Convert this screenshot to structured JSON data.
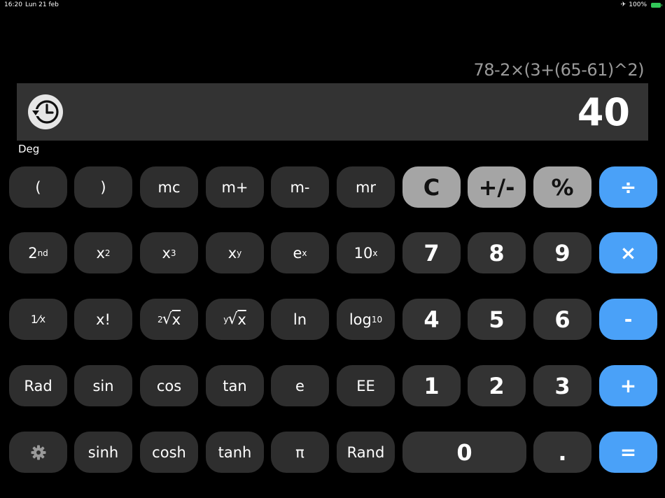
{
  "status": {
    "time": "16:20",
    "date": "Lun 21 feb",
    "battery": "100%"
  },
  "display": {
    "expression": "78-2×(3+(65-61)^2)",
    "result": "40",
    "angle_mode": "Deg"
  },
  "keys": {
    "paren_open": "(",
    "paren_close": ")",
    "mc": "mc",
    "m_plus": "m+",
    "m_minus": "m-",
    "mr": "mr",
    "clear": "C",
    "sign": "+/-",
    "percent": "%",
    "divide": "÷",
    "second_base": "2",
    "second_sup": "nd",
    "x_base": "x",
    "sq_sup": "2",
    "cube_sup": "3",
    "pow_sup": "y",
    "e_base": "e",
    "ex_sup": "x",
    "ten_base": "10",
    "tenx_sup": "x",
    "seven": "7",
    "eight": "8",
    "nine": "9",
    "multiply": "×",
    "reciprocal_num": "1",
    "reciprocal_den": "x",
    "factorial": "x!",
    "sqrt_index": "2",
    "sqrt_sign": "√",
    "sqrt_x": "x",
    "yroot_index": "y",
    "yroot_sign": "√",
    "yroot_x": "x",
    "ln": "ln",
    "log_base": "log",
    "log_sub": "10",
    "four": "4",
    "five": "5",
    "six": "6",
    "minus": "-",
    "rad": "Rad",
    "sin": "sin",
    "cos": "cos",
    "tan": "tan",
    "e": "e",
    "ee": "EE",
    "one": "1",
    "two": "2",
    "three": "3",
    "plus": "+",
    "sinh": "sinh",
    "cosh": "cosh",
    "tanh": "tanh",
    "pi": "π",
    "rand": "Rand",
    "zero": "0",
    "dot": ".",
    "equals": "="
  },
  "colors": {
    "operator": "#4aa1f8",
    "function": "#a5a5a5",
    "key": "#2e2e2e",
    "display_bg": "#333333"
  }
}
